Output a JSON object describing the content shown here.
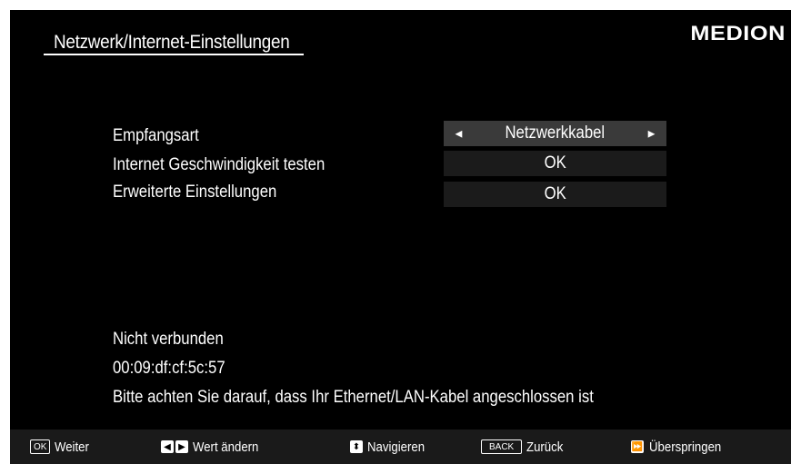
{
  "header": {
    "title": "Netzwerk/Internet-Einstellungen",
    "logo": "MEDION"
  },
  "settings": [
    {
      "label": "Empfangsart",
      "value": "Netzwerkkabel",
      "left_arrow": "◄",
      "right_arrow": "►"
    },
    {
      "label": "Internet Geschwindigkeit testen",
      "value": "OK"
    },
    {
      "label": "Erweiterte Einstellungen",
      "value": "OK"
    }
  ],
  "status": {
    "connection": "Nicht verbunden",
    "mac": "00:09:df:cf:5c:57",
    "message": "Bitte achten Sie darauf, dass Ihr Ethernet/LAN-Kabel angeschlossen ist"
  },
  "footer": {
    "ok_key": "OK",
    "ok_label": "Weiter",
    "left_key": "◀",
    "right_key": "▶",
    "change_label": "Wert ändern",
    "nav_key": "⬍",
    "nav_label": "Navigieren",
    "back_key": "BACK",
    "back_label": "Zurück",
    "skip_key": "⏩",
    "skip_label": "Überspringen"
  }
}
